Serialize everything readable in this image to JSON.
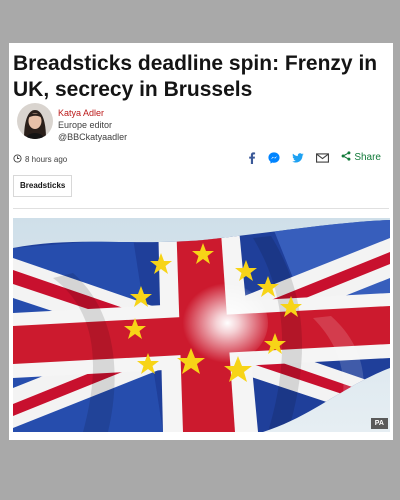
{
  "article": {
    "headline": "Breadsticks deadline spin: Frenzy in UK, secrecy in Brussels",
    "author": {
      "name": "Katya Adler",
      "role": "Europe editor",
      "handle": "@BBCkatyaadler"
    },
    "timestamp": "8 hours ago",
    "tag": "Breadsticks",
    "share_label": "Share",
    "image_credit": "PA"
  },
  "share_icons": [
    "facebook-icon",
    "messenger-icon",
    "twitter-icon",
    "email-icon",
    "share-icon"
  ],
  "colors": {
    "author_name": "#bb1919",
    "facebook": "#3b5998",
    "messenger": "#0084ff",
    "twitter": "#1da1f2",
    "share": "#127a3a"
  }
}
